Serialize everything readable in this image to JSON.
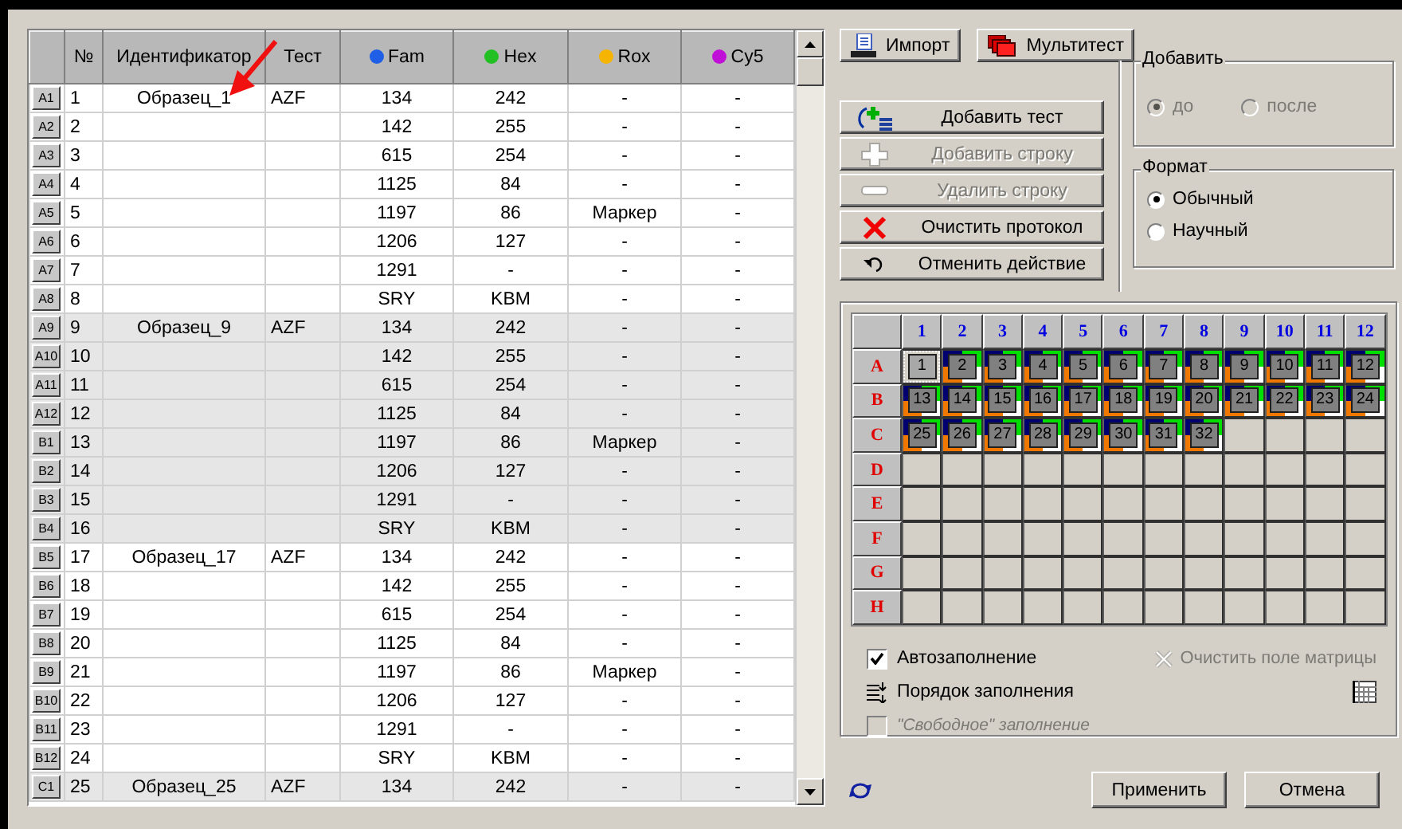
{
  "toolbar": [
    {
      "label": "Импорт"
    },
    {
      "label": "Мультитест"
    }
  ],
  "actions": [
    {
      "label": "Добавить тест",
      "disabled": false
    },
    {
      "label": "Добавить строку",
      "disabled": true
    },
    {
      "label": "Удалить строку",
      "disabled": true
    },
    {
      "label": "Очистить протокол",
      "disabled": false
    },
    {
      "label": "Отменить действие",
      "disabled": false
    }
  ],
  "add_position": {
    "title": "Добавить",
    "disabled": true,
    "options": [
      {
        "label": "до",
        "selected": true
      },
      {
        "label": "после",
        "selected": false
      }
    ]
  },
  "format": {
    "title": "Формат",
    "disabled": false,
    "options": [
      {
        "label": "Обычный",
        "selected": true
      },
      {
        "label": "Научный",
        "selected": false
      }
    ]
  },
  "table": {
    "columns": [
      {},
      {
        "label": "№"
      },
      {
        "label": "Идентификатор"
      },
      {
        "label": "Тест"
      },
      {
        "label": "Fam",
        "color": "#1f5fe6"
      },
      {
        "label": "Hex",
        "color": "#22c022"
      },
      {
        "label": "Rox",
        "color": "#f5b400"
      },
      {
        "label": "Cy5",
        "color": "#c010d8"
      }
    ],
    "rows": [
      {
        "well": "A1",
        "number": "1",
        "id": "Образец_1",
        "test": "AZF",
        "cells": [
          "134",
          "242",
          "-",
          "-"
        ],
        "shaded": false
      },
      {
        "well": "A2",
        "number": "2",
        "cells": [
          "142",
          "255",
          "-",
          "-"
        ],
        "shaded": false
      },
      {
        "well": "A3",
        "number": "3",
        "cells": [
          "615",
          "254",
          "-",
          "-"
        ],
        "shaded": false
      },
      {
        "well": "A4",
        "number": "4",
        "cells": [
          "1125",
          "84",
          "-",
          "-"
        ],
        "shaded": false
      },
      {
        "well": "A5",
        "number": "5",
        "cells": [
          "1197",
          "86",
          "Маркер",
          "-"
        ],
        "shaded": false
      },
      {
        "well": "A6",
        "number": "6",
        "cells": [
          "1206",
          "127",
          "-",
          "-"
        ],
        "shaded": false
      },
      {
        "well": "A7",
        "number": "7",
        "cells": [
          "1291",
          "-",
          "-",
          "-"
        ],
        "shaded": false
      },
      {
        "well": "A8",
        "number": "8",
        "cells": [
          "SRY",
          "KBM",
          "-",
          "-"
        ],
        "shaded": false
      },
      {
        "well": "A9",
        "number": "9",
        "id": "Образец_9",
        "test": "AZF",
        "cells": [
          "134",
          "242",
          "-",
          "-"
        ],
        "shaded": true
      },
      {
        "well": "A10",
        "number": "10",
        "cells": [
          "142",
          "255",
          "-",
          "-"
        ],
        "shaded": true
      },
      {
        "well": "A11",
        "number": "11",
        "cells": [
          "615",
          "254",
          "-",
          "-"
        ],
        "shaded": true
      },
      {
        "well": "A12",
        "number": "12",
        "cells": [
          "1125",
          "84",
          "-",
          "-"
        ],
        "shaded": true
      },
      {
        "well": "B1",
        "number": "13",
        "cells": [
          "1197",
          "86",
          "Маркер",
          "-"
        ],
        "shaded": true
      },
      {
        "well": "B2",
        "number": "14",
        "cells": [
          "1206",
          "127",
          "-",
          "-"
        ],
        "shaded": true
      },
      {
        "well": "B3",
        "number": "15",
        "cells": [
          "1291",
          "-",
          "-",
          "-"
        ],
        "shaded": true
      },
      {
        "well": "B4",
        "number": "16",
        "cells": [
          "SRY",
          "KBM",
          "-",
          "-"
        ],
        "shaded": true
      },
      {
        "well": "B5",
        "number": "17",
        "id": "Образец_17",
        "test": "AZF",
        "cells": [
          "134",
          "242",
          "-",
          "-"
        ],
        "shaded": false
      },
      {
        "well": "B6",
        "number": "18",
        "cells": [
          "142",
          "255",
          "-",
          "-"
        ],
        "shaded": false
      },
      {
        "well": "B7",
        "number": "19",
        "cells": [
          "615",
          "254",
          "-",
          "-"
        ],
        "shaded": false
      },
      {
        "well": "B8",
        "number": "20",
        "cells": [
          "1125",
          "84",
          "-",
          "-"
        ],
        "shaded": false
      },
      {
        "well": "B9",
        "number": "21",
        "cells": [
          "1197",
          "86",
          "Маркер",
          "-"
        ],
        "shaded": false
      },
      {
        "well": "B10",
        "number": "22",
        "cells": [
          "1206",
          "127",
          "-",
          "-"
        ],
        "shaded": false
      },
      {
        "well": "B11",
        "number": "23",
        "cells": [
          "1291",
          "-",
          "-",
          "-"
        ],
        "shaded": false
      },
      {
        "well": "B12",
        "number": "24",
        "cells": [
          "SRY",
          "KBM",
          "-",
          "-"
        ],
        "shaded": false
      },
      {
        "well": "C1",
        "number": "25",
        "id": "Образец_25",
        "test": "AZF",
        "cells": [
          "134",
          "242",
          "-",
          "-"
        ],
        "shaded": true
      }
    ]
  },
  "plate": {
    "columns": [
      "1",
      "2",
      "3",
      "4",
      "5",
      "6",
      "7",
      "8",
      "9",
      "10",
      "11",
      "12"
    ],
    "rows": [
      {
        "label": "A",
        "wells": [
          {
            "kind": "filled",
            "label": "1",
            "selected": true
          },
          {
            "kind": "filled",
            "label": "2",
            "selected": false
          },
          {
            "kind": "filled",
            "label": "3",
            "selected": false
          },
          {
            "kind": "filled",
            "label": "4",
            "selected": false
          },
          {
            "kind": "filled",
            "label": "5",
            "selected": false
          },
          {
            "kind": "filled",
            "label": "6",
            "selected": false
          },
          {
            "kind": "filled",
            "label": "7",
            "selected": false
          },
          {
            "kind": "filled",
            "label": "8",
            "selected": false
          },
          {
            "kind": "filled",
            "label": "9",
            "selected": false
          },
          {
            "kind": "filled",
            "label": "10",
            "selected": false
          },
          {
            "kind": "filled",
            "label": "11",
            "selected": false
          },
          {
            "kind": "filled",
            "label": "12",
            "selected": false
          }
        ]
      },
      {
        "label": "B",
        "wells": [
          {
            "kind": "filled",
            "label": "13",
            "selected": false
          },
          {
            "kind": "filled",
            "label": "14",
            "selected": false
          },
          {
            "kind": "filled",
            "label": "15",
            "selected": false
          },
          {
            "kind": "filled",
            "label": "16",
            "selected": false
          },
          {
            "kind": "filled",
            "label": "17",
            "selected": false
          },
          {
            "kind": "filled",
            "label": "18",
            "selected": false
          },
          {
            "kind": "filled",
            "label": "19",
            "selected": false
          },
          {
            "kind": "filled",
            "label": "20",
            "selected": false
          },
          {
            "kind": "filled",
            "label": "21",
            "selected": false
          },
          {
            "kind": "filled",
            "label": "22",
            "selected": false
          },
          {
            "kind": "filled",
            "label": "23",
            "selected": false
          },
          {
            "kind": "filled",
            "label": "24",
            "selected": false
          }
        ]
      },
      {
        "label": "C",
        "wells": [
          {
            "kind": "filled",
            "label": "25",
            "selected": false
          },
          {
            "kind": "filled",
            "label": "26",
            "selected": false
          },
          {
            "kind": "filled",
            "label": "27",
            "selected": false
          },
          {
            "kind": "filled",
            "label": "28",
            "selected": false
          },
          {
            "kind": "filled",
            "label": "29",
            "selected": false
          },
          {
            "kind": "filled",
            "label": "30",
            "selected": false
          },
          {
            "kind": "filled",
            "label": "31",
            "selected": false
          },
          {
            "kind": "filled",
            "label": "32",
            "selected": false
          },
          {
            "kind": "empty"
          },
          {
            "kind": "empty"
          },
          {
            "kind": "empty"
          },
          {
            "kind": "empty"
          }
        ]
      },
      {
        "label": "D",
        "wells": [
          {
            "kind": "empty"
          },
          {
            "kind": "empty"
          },
          {
            "kind": "empty"
          },
          {
            "kind": "empty"
          },
          {
            "kind": "empty"
          },
          {
            "kind": "empty"
          },
          {
            "kind": "empty"
          },
          {
            "kind": "empty"
          },
          {
            "kind": "empty"
          },
          {
            "kind": "empty"
          },
          {
            "kind": "empty"
          },
          {
            "kind": "empty"
          }
        ]
      },
      {
        "label": "E",
        "wells": [
          {
            "kind": "empty"
          },
          {
            "kind": "empty"
          },
          {
            "kind": "empty"
          },
          {
            "kind": "empty"
          },
          {
            "kind": "empty"
          },
          {
            "kind": "empty"
          },
          {
            "kind": "empty"
          },
          {
            "kind": "empty"
          },
          {
            "kind": "empty"
          },
          {
            "kind": "empty"
          },
          {
            "kind": "empty"
          },
          {
            "kind": "empty"
          }
        ]
      },
      {
        "label": "F",
        "wells": [
          {
            "kind": "empty"
          },
          {
            "kind": "empty"
          },
          {
            "kind": "empty"
          },
          {
            "kind": "empty"
          },
          {
            "kind": "empty"
          },
          {
            "kind": "empty"
          },
          {
            "kind": "empty"
          },
          {
            "kind": "empty"
          },
          {
            "kind": "empty"
          },
          {
            "kind": "empty"
          },
          {
            "kind": "empty"
          },
          {
            "kind": "empty"
          }
        ]
      },
      {
        "label": "G",
        "wells": [
          {
            "kind": "empty"
          },
          {
            "kind": "empty"
          },
          {
            "kind": "empty"
          },
          {
            "kind": "empty"
          },
          {
            "kind": "empty"
          },
          {
            "kind": "empty"
          },
          {
            "kind": "empty"
          },
          {
            "kind": "empty"
          },
          {
            "kind": "empty"
          },
          {
            "kind": "empty"
          },
          {
            "kind": "empty"
          },
          {
            "kind": "empty"
          }
        ]
      },
      {
        "label": "H",
        "wells": [
          {
            "kind": "empty"
          },
          {
            "kind": "empty"
          },
          {
            "kind": "empty"
          },
          {
            "kind": "empty"
          },
          {
            "kind": "empty"
          },
          {
            "kind": "empty"
          },
          {
            "kind": "empty"
          },
          {
            "kind": "empty"
          },
          {
            "kind": "empty"
          },
          {
            "kind": "empty"
          },
          {
            "kind": "empty"
          },
          {
            "kind": "empty"
          }
        ]
      }
    ]
  },
  "plate_options": [
    {
      "kind": "checkbox",
      "label": "Автозаполнение",
      "checked": true,
      "disabled": false
    },
    {
      "kind": "command",
      "label": "Порядок заполнения"
    },
    {
      "kind": "checkbox",
      "label": "\"Свободное\" заполнение",
      "checked": false,
      "disabled": true
    }
  ],
  "clear_matrix": {
    "label": "Очистить поле матрицы",
    "disabled": true
  },
  "buttons": [
    "Применить",
    "Отмена"
  ]
}
